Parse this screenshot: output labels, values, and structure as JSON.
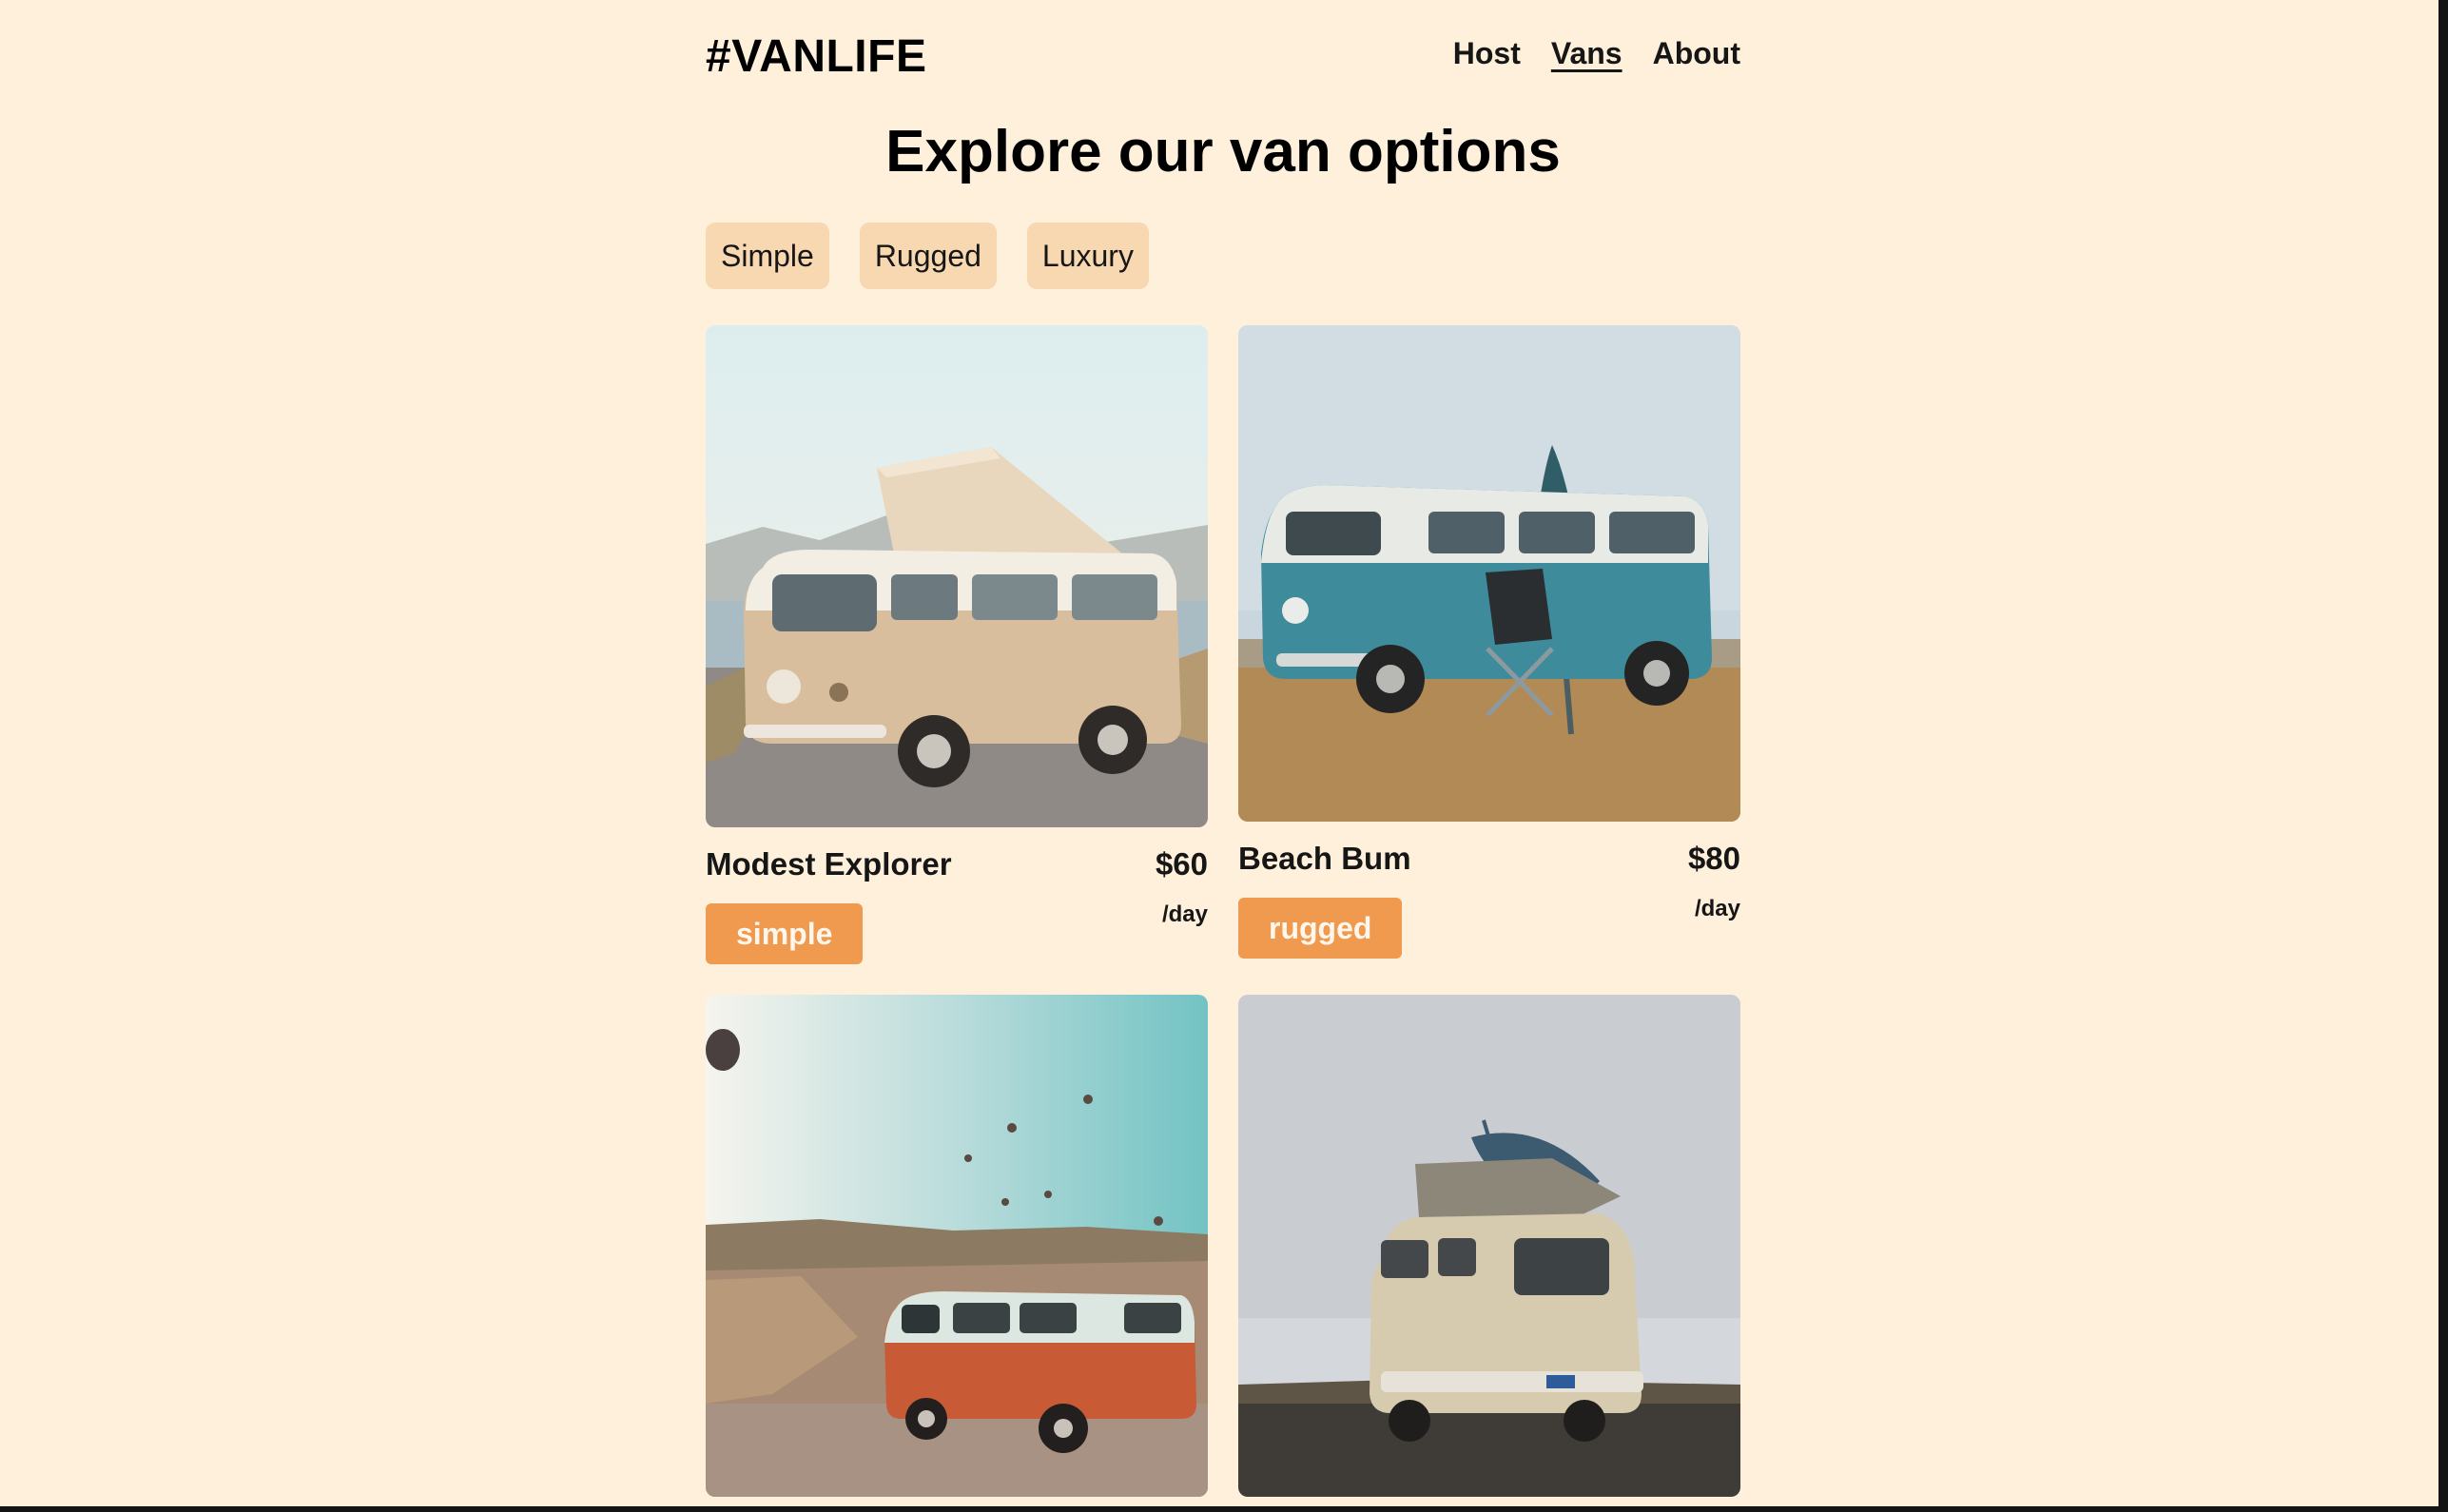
{
  "header": {
    "logo": "#VANLIFE",
    "nav": [
      {
        "label": "Host",
        "active": false
      },
      {
        "label": "Vans",
        "active": true
      },
      {
        "label": "About",
        "active": false
      }
    ]
  },
  "main": {
    "title": "Explore our van options",
    "filters": [
      "Simple",
      "Rugged",
      "Luxury"
    ],
    "vans": [
      {
        "name": "Modest Explorer",
        "price": "$60",
        "unit": "/day",
        "type": "simple",
        "type_color": "#EF9A4F",
        "image": "beige-campervan-coast"
      },
      {
        "name": "Beach Bum",
        "price": "$80",
        "unit": "/day",
        "type": "rugged",
        "type_color": "#EF9A4F",
        "image": "teal-van-campsite"
      },
      {
        "image": "red-van-balloons"
      },
      {
        "image": "cream-van-surfboard"
      }
    ]
  },
  "colors": {
    "background": "#FFF0DC",
    "filter_bg": "#F8D8B0",
    "badge": "#EF9A4F"
  }
}
